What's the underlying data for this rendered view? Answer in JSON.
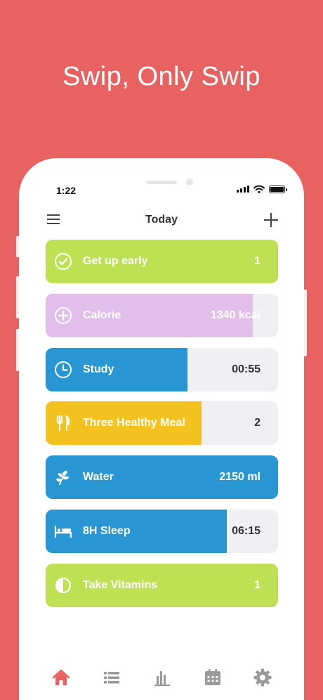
{
  "headline": "Swip, Only Swip",
  "status": {
    "time": "1:22"
  },
  "nav": {
    "title": "Today"
  },
  "habits": [
    {
      "name": "Get up early",
      "value": "1",
      "icon": "check-circle-icon",
      "color": "#BEE154",
      "progress": 1.0,
      "value_color": "#ffffff"
    },
    {
      "name": "Calorie",
      "value": "1340 kcal",
      "icon": "plus-circle-icon",
      "color": "#E2BEEA",
      "progress": 0.89,
      "value_color": "#ffffff"
    },
    {
      "name": "Study",
      "value": "00:55",
      "icon": "clock-icon",
      "color": "#2796D3",
      "progress": 0.61,
      "value_color": "#333333"
    },
    {
      "name": "Three Healthy Meal",
      "value": "2",
      "icon": "fork-knife-icon",
      "color": "#F4C21E",
      "progress": 0.67,
      "value_color": "#333333"
    },
    {
      "name": "Water",
      "value": "2150 ml",
      "icon": "leaf-icon",
      "color": "#2796D3",
      "progress": 1.0,
      "value_color": "#ffffff"
    },
    {
      "name": "8H Sleep",
      "value": "06:15",
      "icon": "bed-icon",
      "color": "#2796D3",
      "progress": 0.78,
      "value_color": "#333333"
    },
    {
      "name": "Take Vitamins",
      "value": "1",
      "icon": "half-circle-icon",
      "color": "#BEE154",
      "progress": 1.0,
      "value_color": "#ffffff"
    }
  ],
  "tabs": [
    {
      "icon": "home-icon",
      "color": "#E86262"
    },
    {
      "icon": "list-icon",
      "color": "#9A9A9A"
    },
    {
      "icon": "bar-chart-icon",
      "color": "#9A9A9A"
    },
    {
      "icon": "calendar-icon",
      "color": "#9A9A9A"
    },
    {
      "icon": "gear-icon",
      "color": "#9A9A9A"
    }
  ],
  "colors": {
    "background": "#E86262",
    "track": "#EFEFF4"
  }
}
